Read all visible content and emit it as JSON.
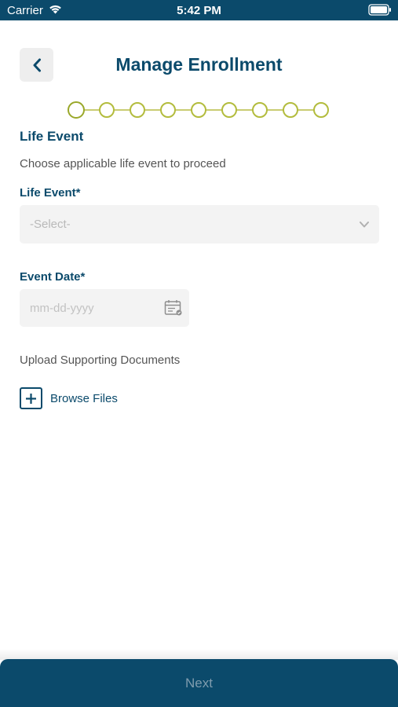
{
  "status_bar": {
    "carrier": "Carrier",
    "time": "5:42 PM"
  },
  "header": {
    "title": "Manage Enrollment",
    "back_icon": "chevron-left-icon"
  },
  "stepper": {
    "total_steps": 9,
    "current_step": 1
  },
  "section": {
    "title": "Life Event",
    "description": "Choose applicable life event to proceed"
  },
  "life_event_field": {
    "label": "Life Event*",
    "value": "-Select-",
    "icon": "chevron-down-icon"
  },
  "event_date_field": {
    "label": "Event Date*",
    "placeholder": "mm-dd-yyyy",
    "icon": "calendar-icon"
  },
  "upload": {
    "label": "Upload Supporting Documents",
    "browse_label": "Browse Files",
    "icon": "plus-icon"
  },
  "footer": {
    "next_label": "Next"
  },
  "colors": {
    "primary": "#0b4a6b",
    "stepper": "#b3bc3d",
    "field_bg": "#f3f3f3"
  }
}
